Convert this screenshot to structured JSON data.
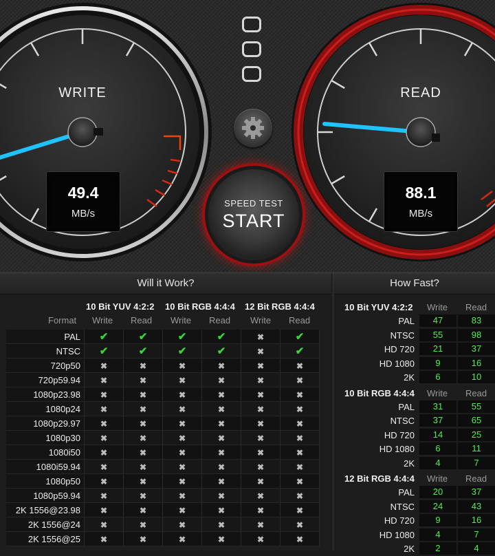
{
  "write_gauge": {
    "label": "WRITE",
    "value": "49.4",
    "unit": "MB/s"
  },
  "read_gauge": {
    "label": "READ",
    "value": "88.1",
    "unit": "MB/s"
  },
  "start_button": {
    "small": "SPEED TEST",
    "big": "START"
  },
  "icons": {
    "settings": "gear-icon",
    "drives": "drive-icon"
  },
  "colors": {
    "needle": "#1ec3ff",
    "read_ring": "#c01818",
    "warn": "#e8450f",
    "ok": "#3cd23c",
    "speed_value": "#4ef04e"
  },
  "will_it_work": {
    "title": "Will it Work?",
    "groups": [
      "10 Bit YUV 4:2:2",
      "10 Bit RGB 4:4:4",
      "12 Bit RGB 4:4:4"
    ],
    "sub": [
      "Write",
      "Read"
    ],
    "format_header": "Format",
    "rows": [
      {
        "name": "PAL",
        "cells": [
          1,
          1,
          1,
          1,
          0,
          1
        ]
      },
      {
        "name": "NTSC",
        "cells": [
          1,
          1,
          1,
          1,
          0,
          1
        ]
      },
      {
        "name": "720p50",
        "cells": [
          0,
          0,
          0,
          0,
          0,
          0
        ]
      },
      {
        "name": "720p59.94",
        "cells": [
          0,
          0,
          0,
          0,
          0,
          0
        ]
      },
      {
        "name": "1080p23.98",
        "cells": [
          0,
          0,
          0,
          0,
          0,
          0
        ]
      },
      {
        "name": "1080p24",
        "cells": [
          0,
          0,
          0,
          0,
          0,
          0
        ]
      },
      {
        "name": "1080p29.97",
        "cells": [
          0,
          0,
          0,
          0,
          0,
          0
        ]
      },
      {
        "name": "1080p30",
        "cells": [
          0,
          0,
          0,
          0,
          0,
          0
        ]
      },
      {
        "name": "1080i50",
        "cells": [
          0,
          0,
          0,
          0,
          0,
          0
        ]
      },
      {
        "name": "1080i59.94",
        "cells": [
          0,
          0,
          0,
          0,
          0,
          0
        ]
      },
      {
        "name": "1080p50",
        "cells": [
          0,
          0,
          0,
          0,
          0,
          0
        ]
      },
      {
        "name": "1080p59.94",
        "cells": [
          0,
          0,
          0,
          0,
          0,
          0
        ]
      },
      {
        "name": "2K 1556@23.98",
        "cells": [
          0,
          0,
          0,
          0,
          0,
          0
        ]
      },
      {
        "name": "2K 1556@24",
        "cells": [
          0,
          0,
          0,
          0,
          0,
          0
        ]
      },
      {
        "name": "2K 1556@25",
        "cells": [
          0,
          0,
          0,
          0,
          0,
          0
        ]
      }
    ]
  },
  "how_fast": {
    "title": "How Fast?",
    "write_label": "Write",
    "read_label": "Read",
    "groups": [
      {
        "name": "10 Bit YUV 4:2:2",
        "rows": [
          {
            "label": "PAL",
            "write": "47",
            "read": "83"
          },
          {
            "label": "NTSC",
            "write": "55",
            "read": "98"
          },
          {
            "label": "HD 720",
            "write": "21",
            "read": "37"
          },
          {
            "label": "HD 1080",
            "write": "9",
            "read": "16"
          },
          {
            "label": "2K",
            "write": "6",
            "read": "10"
          }
        ]
      },
      {
        "name": "10 Bit RGB 4:4:4",
        "rows": [
          {
            "label": "PAL",
            "write": "31",
            "read": "55"
          },
          {
            "label": "NTSC",
            "write": "37",
            "read": "65"
          },
          {
            "label": "HD 720",
            "write": "14",
            "read": "25"
          },
          {
            "label": "HD 1080",
            "write": "6",
            "read": "11"
          },
          {
            "label": "2K",
            "write": "4",
            "read": "7"
          }
        ]
      },
      {
        "name": "12 Bit RGB 4:4:4",
        "rows": [
          {
            "label": "PAL",
            "write": "20",
            "read": "37"
          },
          {
            "label": "NTSC",
            "write": "24",
            "read": "43"
          },
          {
            "label": "HD 720",
            "write": "9",
            "read": "16"
          },
          {
            "label": "HD 1080",
            "write": "4",
            "read": "7"
          },
          {
            "label": "2K",
            "write": "2",
            "read": "4"
          }
        ]
      }
    ]
  }
}
